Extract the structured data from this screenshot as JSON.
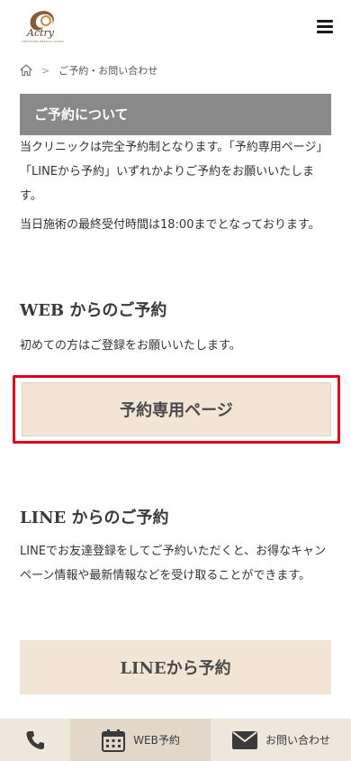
{
  "header": {
    "logo_text": "Actry",
    "logo_subtext": "YOKOHAMA MEDICAL CLINIC",
    "menu_icon": "hamburger-icon"
  },
  "breadcrumb": {
    "home_icon": "home-icon",
    "current": "ご予約・お問い合わせ"
  },
  "reservation_intro": {
    "title": "ご予約について",
    "paragraph1": "当クリニックは完全予約制となります。「予約専用ページ」「LINEから予約」いずれかよりご予約をお願いいたします。",
    "paragraph2": "当日施術の最終受付時間は18:00までとなっております。"
  },
  "web_section": {
    "heading": "WEB からのご予約",
    "note": "初めての方はご登録をお願いいたします。",
    "button_label": "予約専用ページ"
  },
  "line_section": {
    "heading": "LINE からのご予約",
    "description": "LINEでお友達登録をしてご予約いただくと、お得なキャンペーン情報や最新情報などを受け取ることができます。",
    "button_label": "LINEから予約"
  },
  "bottom_nav": {
    "phone_icon": "phone-icon",
    "web_label": "WEB予約",
    "web_icon": "calendar-icon",
    "contact_label": "お問い合わせ",
    "contact_icon": "mail-icon"
  },
  "colors": {
    "section_bar": "#898989",
    "button_bg": "#f3e5d6",
    "highlight_border": "#e0001b",
    "bottom_bar": "#efe6dc"
  }
}
